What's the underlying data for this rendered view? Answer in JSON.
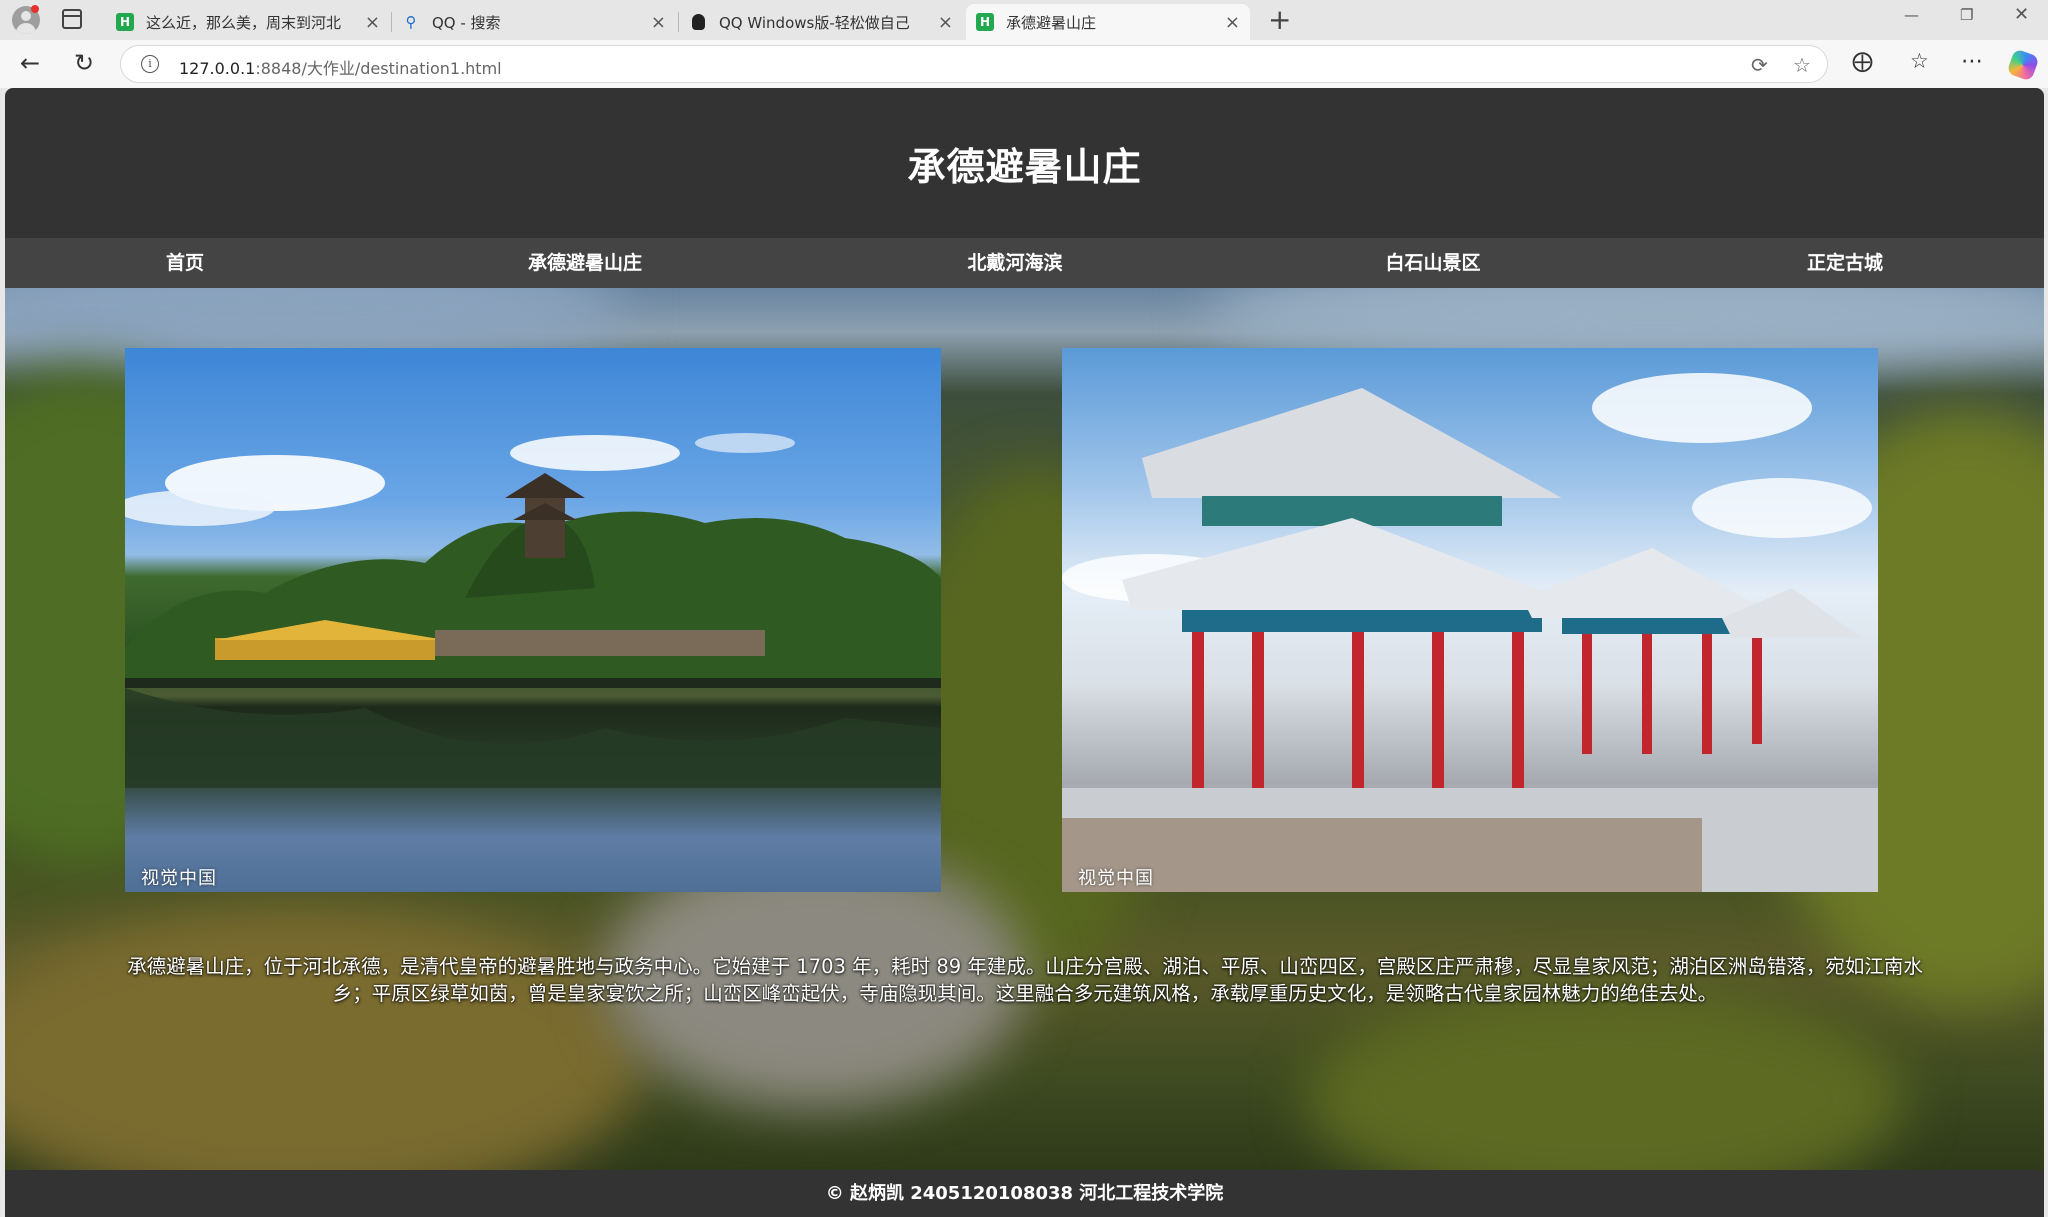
{
  "browser": {
    "tabs": [
      {
        "label": "这么近，那么美，周末到河北",
        "favicon": "h5-icon",
        "active": false
      },
      {
        "label": "QQ - 搜索",
        "favicon": "search-icon",
        "active": false
      },
      {
        "label": "QQ Windows版-轻松做自己",
        "favicon": "qq-icon",
        "active": false
      },
      {
        "label": "承德避暑山庄",
        "favicon": "h5-icon",
        "active": true
      }
    ],
    "tab_close_glyph": "×",
    "new_tab_glyph": "+",
    "address": {
      "host": "127.0.0.1",
      "path": ":8848/大作业/destination1.html"
    }
  },
  "site": {
    "title": "承德避暑山庄",
    "nav": [
      "首页",
      "承德避暑山庄",
      "北戴河海滨",
      "白石山景区",
      "正定古城"
    ],
    "photos": [
      {
        "watermark": "视觉中国",
        "subject": "lake-pavilion"
      },
      {
        "watermark": "视觉中国",
        "subject": "snowy-corridor-pavilion"
      }
    ],
    "description": "承德避暑山庄，位于河北承德，是清代皇帝的避暑胜地与政务中心。它始建于 1703 年，耗时 89 年建成。山庄分宫殿、湖泊、平原、山峦四区，宫殿区庄严肃穆，尽显皇家风范；湖泊区洲岛错落，宛如江南水乡；平原区绿草如茵，曾是皇家宴饮之所；山峦区峰峦起伏，寺庙隐现其间。这里融合多元建筑风格，承载厚重历史文化，是领略古代皇家园林魅力的绝佳去处。",
    "footer": "© 赵炳凯 2405120108038 河北工程技术学院"
  },
  "colors": {
    "header_bg": "#333333",
    "nav_bg": "#444444",
    "footer_bg": "#333333",
    "text": "#ffffff"
  }
}
